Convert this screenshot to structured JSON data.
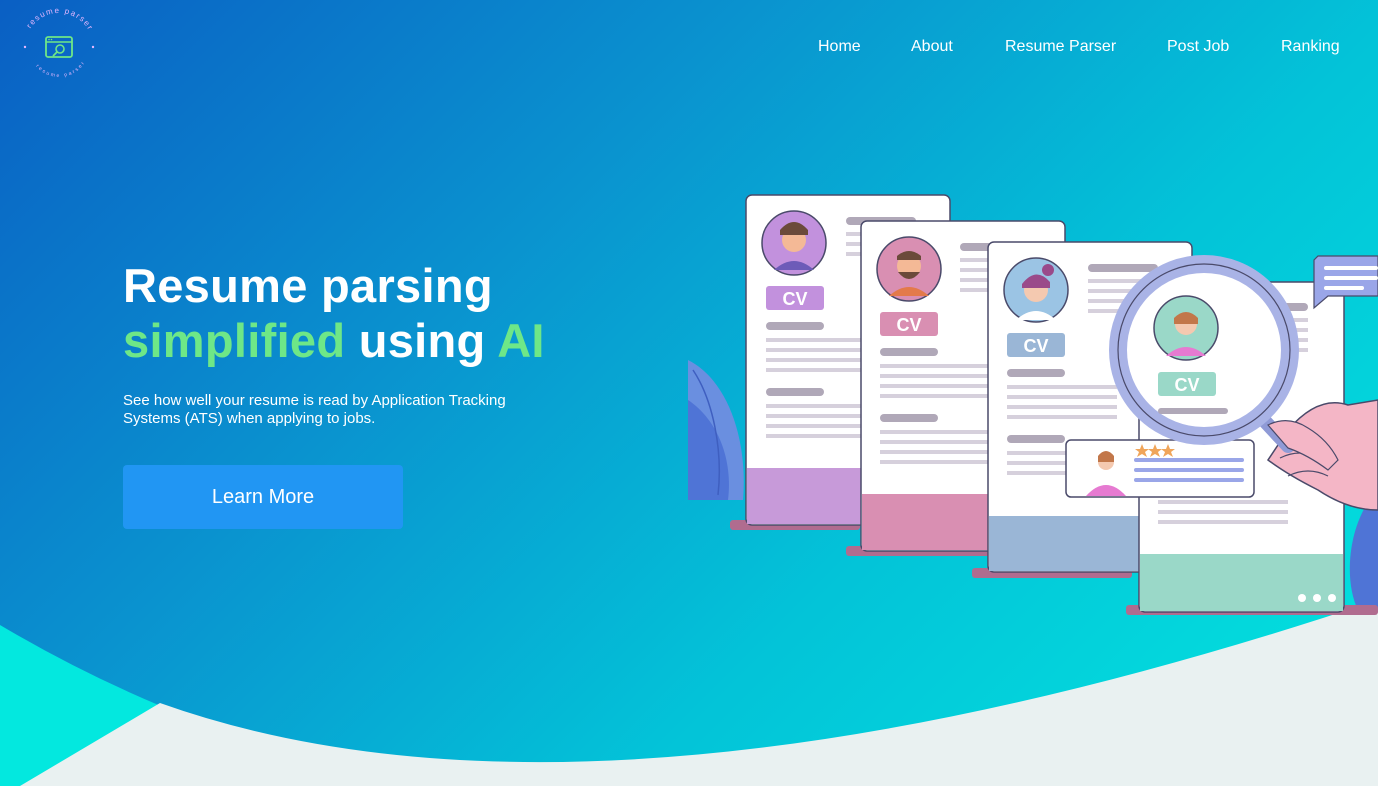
{
  "logo": {
    "ring_text_top": "resume parser",
    "ring_text_bottom": "resume parser",
    "icon": "browser-search-icon",
    "accent_color": "#6ee787"
  },
  "nav": {
    "items": [
      {
        "label": "Home"
      },
      {
        "label": "About"
      },
      {
        "label": "Resume Parser"
      },
      {
        "label": "Post Job"
      },
      {
        "label": "Ranking"
      }
    ]
  },
  "hero": {
    "title_line1": "Resume parsing",
    "title_green1": "simplified",
    "title_mid": " using ",
    "title_green2": "AI",
    "subtitle": "See how well your resume is read by Application Tracking Systems (ATS) when applying to jobs.",
    "cta_label": "Learn More"
  },
  "illustration": {
    "cv_label": "CV",
    "icons": [
      "cv-card-icon",
      "magnifier-icon",
      "hand-icon",
      "chat-bubble-icon",
      "star-icon"
    ]
  },
  "colors": {
    "brand_blue": "#2196f3",
    "accent_green": "#6ee787",
    "wave_light": "#e9f1f1"
  }
}
